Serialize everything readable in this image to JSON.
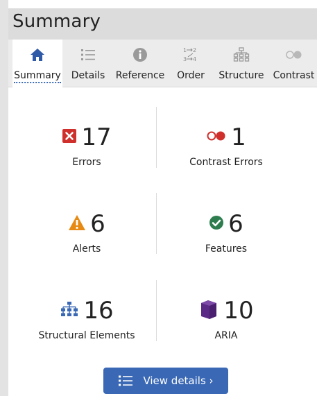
{
  "header": {
    "title": "Summary"
  },
  "tabs": [
    {
      "label": "Summary",
      "icon": "home-icon",
      "active": true
    },
    {
      "label": "Details",
      "icon": "list-icon",
      "active": false
    },
    {
      "label": "Reference",
      "icon": "info-icon",
      "active": false
    },
    {
      "label": "Order",
      "icon": "order-icon",
      "active": false
    },
    {
      "label": "Structure",
      "icon": "structure-icon",
      "active": false
    },
    {
      "label": "Contrast",
      "icon": "contrast-icon",
      "active": false
    }
  ],
  "stats": {
    "errors": {
      "count": "17",
      "label": "Errors",
      "icon": "error-icon",
      "color": "#d0302c"
    },
    "contrast_errors": {
      "count": "1",
      "label": "Contrast Errors",
      "icon": "contrast-error-icon",
      "color": "#d0302c"
    },
    "alerts": {
      "count": "6",
      "label": "Alerts",
      "icon": "alert-icon",
      "color": "#e68a14"
    },
    "features": {
      "count": "6",
      "label": "Features",
      "icon": "feature-check-icon",
      "color": "#2e7d4f"
    },
    "structural": {
      "count": "16",
      "label": "Structural Elements",
      "icon": "structure-icon",
      "color": "#3a68b5"
    },
    "aria": {
      "count": "10",
      "label": "ARIA",
      "icon": "aria-cube-icon",
      "color": "#5b2a86"
    }
  },
  "view_details": {
    "label": "View details ›",
    "icon": "list-icon"
  },
  "colors": {
    "accent": "#3a68b5",
    "header_bg": "#dcdcdc",
    "tabbar_bg": "#ececec"
  }
}
